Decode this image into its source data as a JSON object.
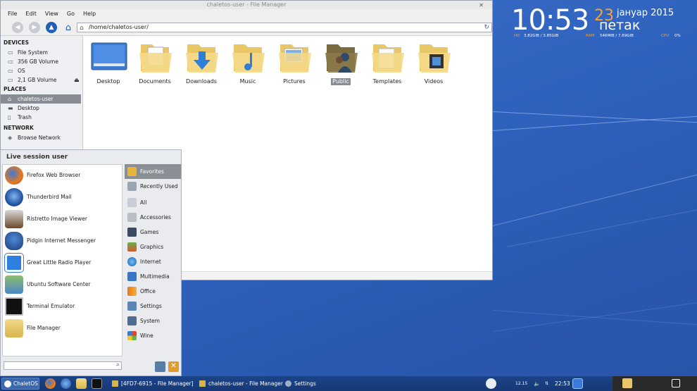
{
  "clock": {
    "time": "10:53",
    "day": "23",
    "month": "јануар 2015",
    "weekday": "петак",
    "hd_label": "HD",
    "hd_value": "3.82GIB / 3.85GIB",
    "ram_label": "RAM",
    "ram_value": "546MIB / 7.69GIB",
    "cpu_label": "CPU",
    "cpu_value": "0%"
  },
  "filemanager": {
    "title": "chaletos-user - File Manager",
    "menus": [
      "File",
      "Edit",
      "View",
      "Go",
      "Help"
    ],
    "location": "/home/chaletos-user/",
    "sidebar": {
      "devices_header": "DEVICES",
      "devices": [
        "File System",
        "356 GB Volume",
        "OS",
        "2,1 GB Volume"
      ],
      "places_header": "PLACES",
      "places": [
        "chaletos-user",
        "Desktop",
        "Trash"
      ],
      "network_header": "NETWORK",
      "network": [
        "Browse Network"
      ]
    },
    "folders": [
      "Desktop",
      "Documents",
      "Downloads",
      "Music",
      "Pictures",
      "Public",
      "Templates",
      "Videos"
    ]
  },
  "menu": {
    "header": "Live session user",
    "apps": [
      "Firefox Web Browser",
      "Thunderbird Mail",
      "Ristretto Image Viewer",
      "Pidgin Internet Messenger",
      "Great Little Radio Player",
      "Ubuntu Software Center",
      "Terminal Emulator",
      "File Manager"
    ],
    "categories": [
      "Favorites",
      "Recently Used",
      "All",
      "Accessories",
      "Games",
      "Graphics",
      "Internet",
      "Multimedia",
      "Office",
      "Settings",
      "System",
      "Wine"
    ]
  },
  "taskbar": {
    "start_label": "ChaletOS",
    "tasks": [
      "[4FD7-6915 - File Manager]",
      "chaletos-user - File Manager",
      "Settings"
    ],
    "tray_number": "12.15",
    "clock": "22:53"
  }
}
